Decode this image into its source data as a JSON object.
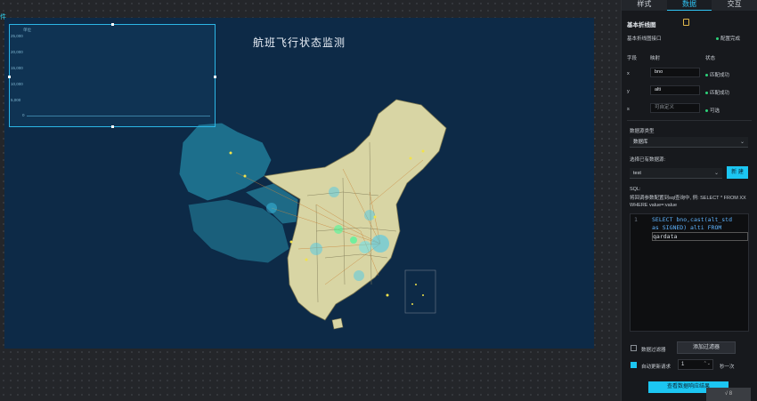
{
  "workspace": {
    "edge_label": "件"
  },
  "canvas": {
    "title": "航班飞行状态监测"
  },
  "chart_box": {
    "unit_label": "单位",
    "y_ticks": [
      "25,000",
      "20,000",
      "15,000",
      "10,000",
      "5,000",
      "0"
    ]
  },
  "panel": {
    "tabs": [
      {
        "label": "样式"
      },
      {
        "label": "数据"
      },
      {
        "label": "交互"
      }
    ],
    "title": "基本折线图",
    "interface_label": "基本折线图接口",
    "config_status": "配置完成",
    "columns": {
      "field": "字段",
      "mapping": "映射",
      "status": "状态"
    },
    "fields": [
      {
        "name": "x",
        "value": "bno",
        "status": "匹配成功"
      },
      {
        "name": "y",
        "value": "alti",
        "status": "匹配成功"
      },
      {
        "name": "s",
        "value": "可自定义",
        "status": "可选"
      }
    ],
    "datasource_type_label": "数据源类型",
    "datasource_type_value": "数据库",
    "choose_source_label": "选择已有数据源:",
    "choose_source_value": "test",
    "new_button": "新 建",
    "sql_label": "SQL:",
    "sql_hint": "将回调参数配置到sql查询中, 例: SELECT * FROM XX WHERE value=:value",
    "code": {
      "line_number": "1",
      "line1": "SELECT bno,cast(alt_std",
      "line2": "as SIGNED) alti FROM",
      "line3": "qardata"
    },
    "filter_label": "数据过滤器",
    "add_filter_button": "添加过滤器",
    "auto_update_label": "自动更新请求",
    "auto_update_value": "1",
    "seconds_label": "秒一次",
    "view_button": "查看数据响应结果",
    "corner_label": "√ 8"
  }
}
